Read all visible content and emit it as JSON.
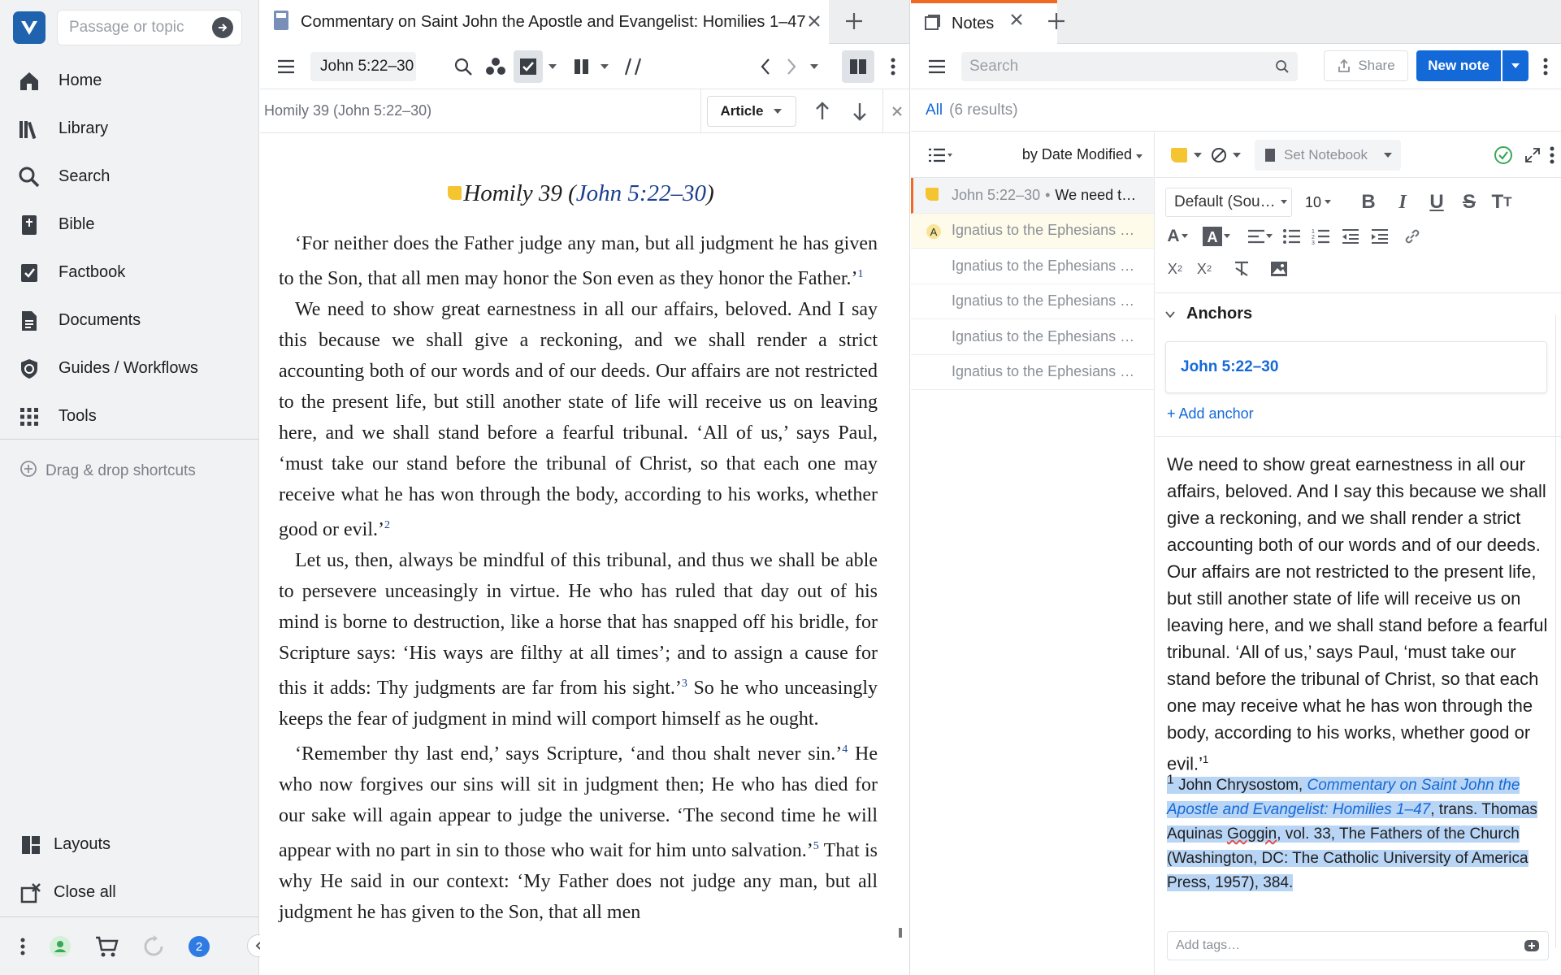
{
  "sidebar": {
    "passage_placeholder": "Passage or topic",
    "items": [
      {
        "label": "Home",
        "icon": "home-icon"
      },
      {
        "label": "Library",
        "icon": "library-icon"
      },
      {
        "label": "Search",
        "icon": "search-icon"
      },
      {
        "label": "Bible",
        "icon": "bible-icon"
      },
      {
        "label": "Factbook",
        "icon": "factbook-icon"
      },
      {
        "label": "Documents",
        "icon": "documents-icon"
      },
      {
        "label": "Guides / Workflows",
        "icon": "guides-icon"
      },
      {
        "label": "Tools",
        "icon": "tools-icon"
      }
    ],
    "drag_drop": "Drag & drop shortcuts",
    "bottom": [
      {
        "label": "Layouts",
        "icon": "layouts-icon"
      },
      {
        "label": "Close all",
        "icon": "close-all-icon"
      }
    ],
    "badge_count": "2"
  },
  "reader": {
    "tab_title": "Commentary on Saint John the Apostle and Evangelist: Homilies 1–47",
    "reference": "John 5:22–30",
    "subtitle": "Homily 39 (John 5:22–30)",
    "article_label": "Article",
    "heading_prefix": "Homily 39 (",
    "heading_ref": "John 5:22–30",
    "heading_suffix": ")",
    "paragraphs": [
      {
        "text": "‘For neither does the Father judge any man, but all judgment he has given to the Son, that all men may honor the Son even as they honor the Father.’",
        "fn": "1"
      },
      {
        "text": "We need to show great earnestness in all our affairs, beloved. And I say this because we shall give a reckoning, and we shall render a strict accounting both of our words and of our deeds. Our affairs are not restricted to the present life, but still another state of life will receive us on leaving here, and we shall stand before a fearful tribunal. ‘All of us,’ says Paul, ‘must take our stand before the tribunal of Christ, so that each one may receive what he has won through the body, according to his works, whether good or evil.’",
        "fn": "2"
      },
      {
        "text": "Let us, then, always be mindful of this tribunal, and thus we shall be able to persevere unceasingly in virtue. He who has ruled that day out of his mind is borne to destruction, like a horse that has snapped off his bridle, for Scripture says: ‘His ways are filthy at all times’; and to assign a cause for this it adds: Thy judgments are far from his sight.’",
        "fn": "3",
        "after": " So he who unceasingly keeps the fear of judgment in mind will comport himself as he ought."
      },
      {
        "text": "‘Remember thy last end,’ says Scripture, ‘and thou shalt never sin.’",
        "fn": "4",
        "after": " He who now forgives our sins will sit in judgment then; He who has died for our sake will again appear to judge the universe. ‘The second time he will appear with no part in sin to those who wait for him unto salvation.’",
        "fn2": "5",
        "after2": " That is why He said in our context: ‘My Father does not judge any man, but all judgment he has given to the Son, that all men"
      }
    ]
  },
  "notes": {
    "tab_title": "Notes",
    "search_placeholder": "Search",
    "share_label": "Share",
    "new_note_label": "New note",
    "results_all": "All",
    "results_count": "(6 results)",
    "sort_label": "by Date Modified",
    "list": [
      {
        "ref": "John 5:22–30",
        "sep": "•",
        "snippet": "We need t…",
        "active": true
      },
      {
        "ref": "Ignatius to the Ephesians …",
        "icon": "A"
      },
      {
        "ref": "Ignatius to the Ephesians …"
      },
      {
        "ref": "Ignatius to the Ephesians …"
      },
      {
        "ref": "Ignatius to the Ephesians …"
      },
      {
        "ref": "Ignatius to the Ephesians …"
      }
    ],
    "set_notebook": "Set Notebook",
    "font_name": "Default (Sou…",
    "font_size": "10",
    "anchors_title": "Anchors",
    "anchor_ref": "John 5:22–30",
    "add_anchor": "+ Add anchor",
    "body": "We need to show great earnestness in all our affairs, beloved. And I say this because we shall give a reckoning, and we shall render a strict accounting both of our words and of our deeds. Our affairs are not restricted to the present life, but still another state of life will receive us on leaving here, and we shall stand before a fearful tribunal. ‘All of us,’ says Paul, ‘must take our stand before the tribunal of Christ, so that each one may receive what he has won through the body, according to his works, whether good or evil.’",
    "body_fn": "1",
    "footnote_num": "1",
    "footnote_author": " John Chrysostom, ",
    "footnote_title": "Commentary on Saint John the Apostle and Evangelist: Homilies 1–47",
    "footnote_trans": ", trans. Thomas Aquinas ",
    "footnote_name": "Goggin",
    "footnote_rest": ", vol. 33, The Fathers of the Church (Washington, DC: The Catholic University of America Press, 1957), 384.",
    "tags_placeholder": "Add tags…"
  },
  "colors": {
    "accent": "#1469d8",
    "tab_highlight": "#f06a24",
    "note_yellow": "#f5c431",
    "selection": "#b9d5f5"
  }
}
